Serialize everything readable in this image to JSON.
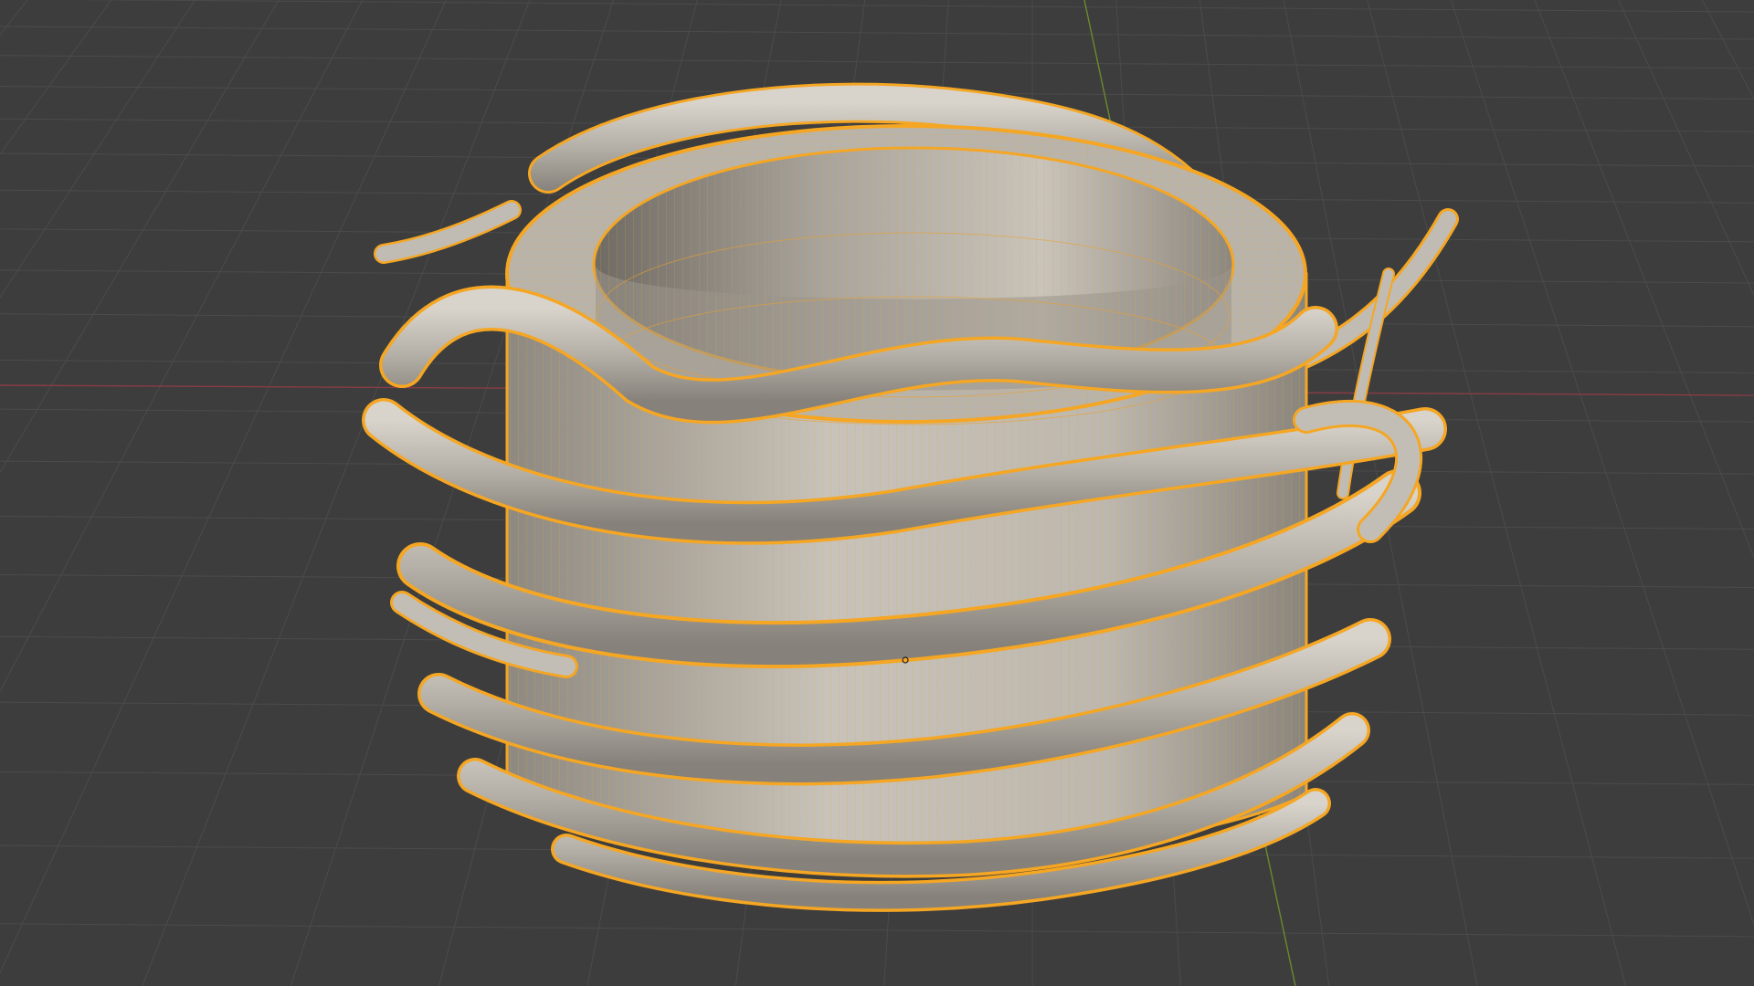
{
  "viewport": {
    "background": "#3d3d3d",
    "grid_color": "#4b4b4b",
    "x_axis_color": "#8a3c46",
    "y_axis_color": "#6b8a2c",
    "selection_outline_color": "#f5a623",
    "wire_color": "#e8a032",
    "mesh_face_color": "#b3aea6",
    "mesh_shadow_color": "#7d7870",
    "mesh_highlight_color": "#d6d1c8",
    "object_origin_icon": "origin-dot-icon"
  }
}
